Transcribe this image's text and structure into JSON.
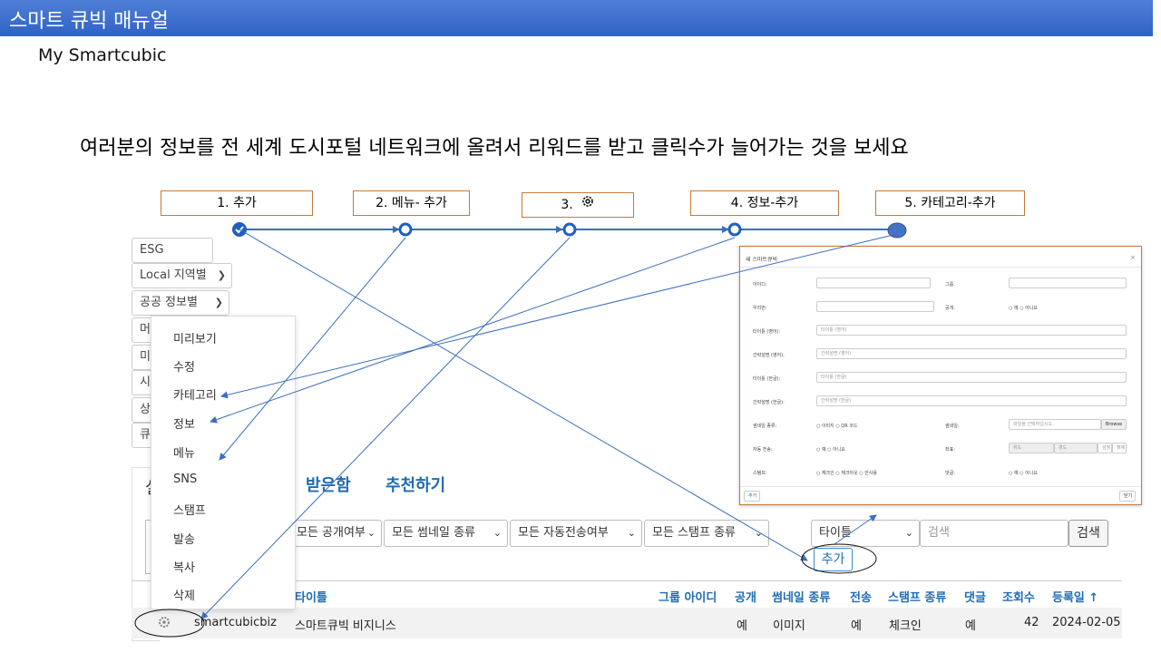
{
  "header": {
    "title": "스마트 큐빅 매뉴얼"
  },
  "subtitle": "My Smartcubic",
  "headline": "여러분의 정보를 전 세계 도시포털 네트워크에 올려서 리워드를 받고 클릭수가 늘어가는 것을 보세요",
  "steps": [
    {
      "label": "1.  추가"
    },
    {
      "label": "2.  메뉴- 추가"
    },
    {
      "label": "3."
    },
    {
      "label": "4. 정보-추가"
    },
    {
      "label": "5. 카테고리-추가"
    }
  ],
  "sidebar": {
    "items": [
      {
        "label": "ESG"
      },
      {
        "label": "Local 지역별"
      },
      {
        "label": "공공 정보별"
      },
      {
        "label": "머"
      },
      {
        "label": "미"
      },
      {
        "label": "시"
      },
      {
        "label": "상"
      },
      {
        "label": "큐"
      }
    ],
    "tab_fragment": "실"
  },
  "context_menu": {
    "items": [
      "미리보기",
      "수정",
      "카테고리",
      "정보",
      "메뉴",
      "SNS",
      "스탬프",
      "발송",
      "복사",
      "삭제"
    ]
  },
  "tabs": {
    "received": "받은함",
    "recommend": "추천하기"
  },
  "filters": {
    "public": "모든 공개여부",
    "thumbnail": "모든 썸네일 종류",
    "autosend": "모든 자동전송여부",
    "stamp": "모든 스탬프 종류",
    "search_field": "타이틀",
    "search_placeholder": "검색",
    "search_button": "검색",
    "add_button": "추가"
  },
  "table": {
    "headers": [
      "타이틀",
      "그룹 아이디",
      "공개",
      "썸네일 종류",
      "전송",
      "스탬프 종류",
      "댓글",
      "조회수",
      "등록일 ↑"
    ],
    "row": {
      "id": "smartcubicbiz",
      "title": "스마트큐빅 비지니스",
      "public": "예",
      "thumbnail": "이미지",
      "send": "예",
      "stamp": "체크인",
      "comment": "예",
      "views": "42",
      "date": "2024-02-05"
    }
  },
  "modal": {
    "title": "새 스마트큐빅",
    "close": "×",
    "fields": {
      "id": "아이디:",
      "group": "그룹:",
      "ordinal": "우리번:",
      "public": "공개:",
      "title_en": "타이틀 (영어):",
      "title_en_ph": "타이틀 (영어)",
      "desc_en": "간략설명 (영어):",
      "desc_en_ph": "간략설명 (영어)",
      "title_ko": "타이틀 (한글):",
      "title_ko_ph": "타이틀 (한글)",
      "desc_ko": "간략설명 (한글):",
      "desc_ko_ph": "간략설명 (한글)",
      "thumb_type": "썸네일 종류:",
      "thumb_opts": "○ 이미지  ○ QR 코드",
      "thumb": "썸네일:",
      "thumb_ph": "파일을 선택하십시오.",
      "browse": "Browse",
      "autosend": "자동 전송:",
      "yesno": "○ 예  ○ 아니요",
      "coord": "좌표:",
      "lat": "위도",
      "lng": "경도",
      "set": "설정",
      "clear": "해제",
      "stamp": "스탬프:",
      "stamp_opts": "○ 체크인  ○ 체크아웃  ○ 안사용",
      "comment": "댓글:",
      "yesno2": "○ 예  ○ 아니요",
      "public_opts": "○ 예  ○ 아니요"
    },
    "add_button": "추가",
    "close_button": "닫기"
  },
  "colors": {
    "accent": "#2f62c7",
    "link": "#1f6cb5",
    "step_border": "#c47a38"
  }
}
